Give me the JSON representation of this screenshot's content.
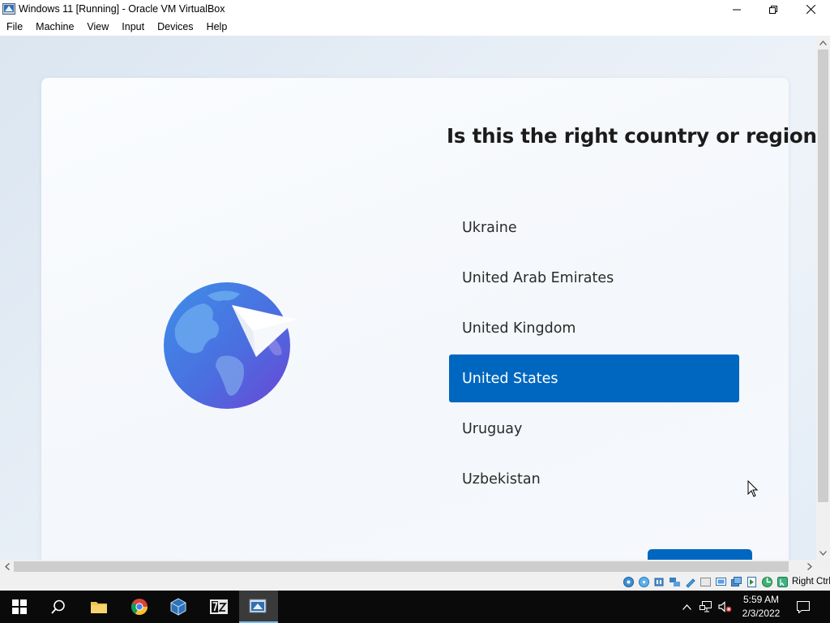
{
  "window": {
    "title": "Windows 11 [Running] - Oracle VM VirtualBox",
    "controls": [
      "minimize-icon",
      "maximize-icon",
      "close-icon"
    ]
  },
  "menubar": {
    "items": [
      "File",
      "Machine",
      "View",
      "Input",
      "Devices",
      "Help"
    ]
  },
  "oobe": {
    "question": "Is this the right country or region?",
    "countries": [
      {
        "label": "Ukraine",
        "selected": false
      },
      {
        "label": "United Arab Emirates",
        "selected": false
      },
      {
        "label": "United Kingdom",
        "selected": false
      },
      {
        "label": "United States",
        "selected": true
      },
      {
        "label": "Uruguay",
        "selected": false
      },
      {
        "label": "Uzbekistan",
        "selected": false
      }
    ],
    "illustration": "globe-with-paper-plane-icon"
  },
  "statusbar": {
    "icons": [
      "hard-disk-icon",
      "optical-drive-icon",
      "audio-icon",
      "network-icon",
      "usb-icon",
      "shared-folders-icon",
      "display-icon",
      "video-capture-icon",
      "recording-icon",
      "cpu-icon",
      "mouse-integration-icon",
      "keyboard-capture-icon"
    ],
    "host_key": "Right Ctrl"
  },
  "taskbar": {
    "apps": [
      "start-icon",
      "search-icon",
      "file-explorer-icon",
      "chrome-icon",
      "virtualbox-icon",
      "7zip-icon",
      "virtualbox-vm-icon"
    ],
    "clock_time": "5:59 AM",
    "clock_date": "2/3/2022"
  },
  "colors": {
    "accent": "#0067c0",
    "taskbar": "#0a0a0a",
    "selection_text": "#ffffff"
  }
}
